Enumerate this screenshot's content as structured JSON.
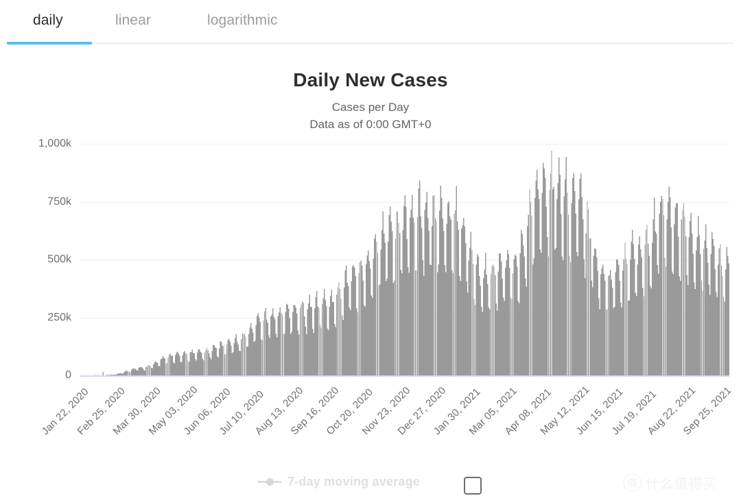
{
  "tabs": [
    {
      "label": "daily",
      "active": true
    },
    {
      "label": "linear",
      "active": false
    },
    {
      "label": "logarithmic",
      "active": false
    }
  ],
  "accent_color": "#54c0f2",
  "header": {
    "title": "Daily New Cases",
    "subtitle1": "Cases per Day",
    "subtitle2": "Data as of 0:00 GMT+0"
  },
  "legend": {
    "label": "7-day moving average",
    "checkbox_checked": false,
    "marker_color": "#dcdcdc"
  },
  "watermark": {
    "badge": "值",
    "text": "什么值得买"
  },
  "chart_data": {
    "type": "bar",
    "title": "Daily New Cases",
    "subtitle": "Cases per Day",
    "xlabel": "",
    "ylabel": "",
    "ylim": [
      0,
      1000000
    ],
    "grid": true,
    "legend_position": "bottom",
    "bar_color": "#9a9a9a",
    "gridline_color": "#eceef0",
    "baseline_color": "#d3d8e6",
    "series_name": "Daily New Cases",
    "y_ticks": [
      0,
      250000,
      500000,
      750000,
      1000000
    ],
    "y_tick_labels": [
      "0",
      "250k",
      "500k",
      "750k",
      "1,000k"
    ],
    "x_tick_labels": [
      "Jan 22, 2020",
      "Feb 25, 2020",
      "Mar 30, 2020",
      "May 03, 2020",
      "Jun 06, 2020",
      "Jul 10, 2020",
      "Aug 13, 2020",
      "Sep 16, 2020",
      "Oct 20, 2020",
      "Nov 23, 2020",
      "Dec 27, 2020",
      "Jan 30, 2021",
      "Mar 05, 2021",
      "Apr 08, 2021",
      "May 12, 2021",
      "Jun 15, 2021",
      "Jul 19, 2021",
      "Aug 22, 2021",
      "Sep 25, 2021"
    ],
    "x_start": "Jan 22, 2020",
    "x_end": "Oct 02, 2021",
    "x_tick_step_days": 34,
    "n_points": 620,
    "peak_value": 905000,
    "peak_date": "Apr 29, 2021",
    "monthly_baseline": [
      {
        "month": "Jan 2020",
        "value": 1000
      },
      {
        "month": "Feb 2020",
        "value": 3000
      },
      {
        "month": "Mar 2020",
        "value": 30000
      },
      {
        "month": "Apr 2020",
        "value": 78000
      },
      {
        "month": "May 2020",
        "value": 95000
      },
      {
        "month": "Jun 2020",
        "value": 135000
      },
      {
        "month": "Jul 2020",
        "value": 225000
      },
      {
        "month": "Aug 2020",
        "value": 260000
      },
      {
        "month": "Sep 2020",
        "value": 285000
      },
      {
        "month": "Oct 2020",
        "value": 400000
      },
      {
        "month": "Nov 2020",
        "value": 570000
      },
      {
        "month": "Dec 2020",
        "value": 640000
      },
      {
        "month": "Jan 2021",
        "value": 640000
      },
      {
        "month": "Feb 2021",
        "value": 400000
      },
      {
        "month": "Mar 2021",
        "value": 440000
      },
      {
        "month": "Apr 2021",
        "value": 760000
      },
      {
        "month": "May 2021",
        "value": 700000
      },
      {
        "month": "Jun 2021",
        "value": 380000
      },
      {
        "month": "Jul 2021",
        "value": 480000
      },
      {
        "month": "Aug 2021",
        "value": 650000
      },
      {
        "month": "Sep 2021",
        "value": 520000
      },
      {
        "month": "Oct 2021",
        "value": 430000
      }
    ],
    "weekly_pattern_note": "strong 7-day oscillation; weekend troughs ~25% below trend, midweek peaks ~25% above"
  }
}
